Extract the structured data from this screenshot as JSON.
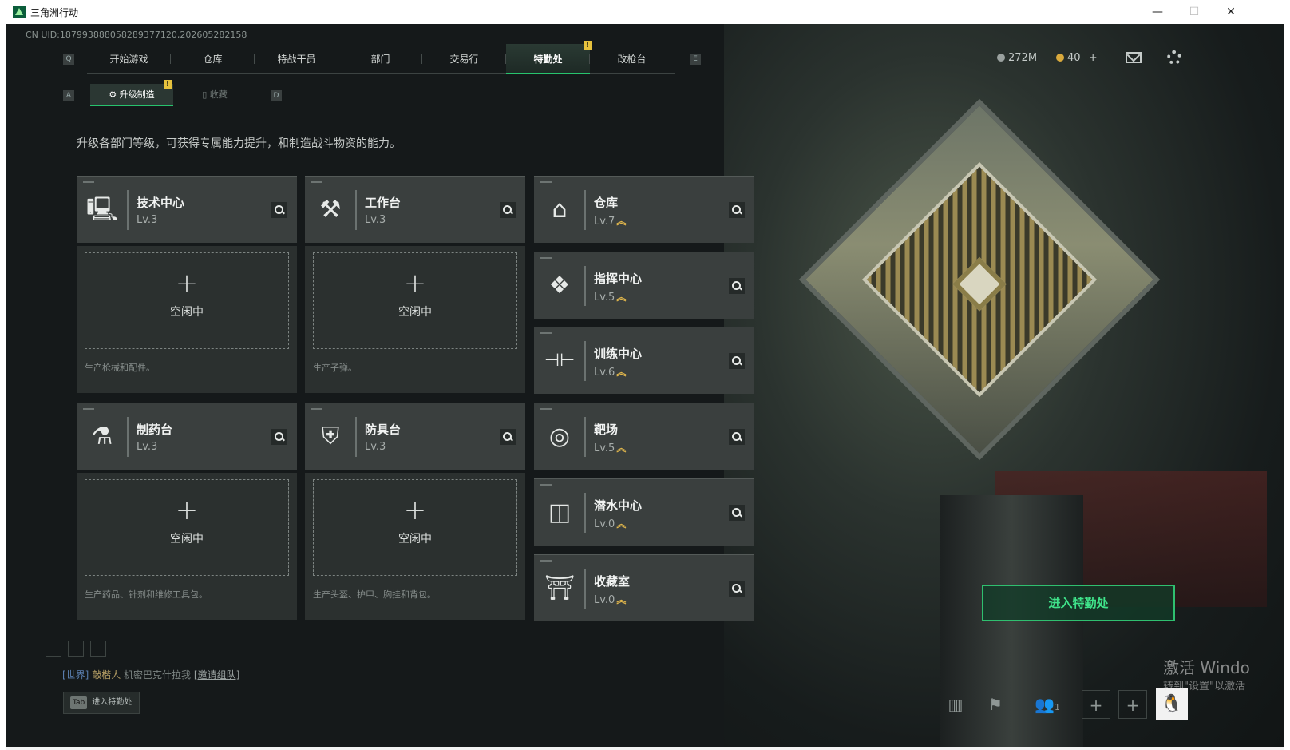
{
  "window": {
    "title": "三角洲行动",
    "minimize": "—",
    "maximize": "☐",
    "close": "✕"
  },
  "uid": "CN UID:1879938880582893771​20,202605282158",
  "nav": {
    "key_left": "Q",
    "key_right": "E",
    "tabs": [
      "开始游戏",
      "仓库",
      "特战干员",
      "部门",
      "交易行",
      "特勤处",
      "改枪台"
    ],
    "active_tab": "特勤处",
    "badge": "!"
  },
  "resources": {
    "money": "272M",
    "coin": "40",
    "coin_plus": "+"
  },
  "subnav": {
    "key_left": "A",
    "key_right": "D",
    "tabs": [
      "升级制造",
      "收藏"
    ],
    "badge": "!"
  },
  "description": "升级各部门等级，可获得专属能力提升，和制造战斗物资的能力。",
  "production": [
    {
      "name": "技术中心",
      "level": "Lv.3",
      "icon": "monitor-icon",
      "glyph": "🖳",
      "slot": "空闲中",
      "plus": "+",
      "note": "生产枪械和配件。"
    },
    {
      "name": "工作台",
      "level": "Lv.3",
      "icon": "tools-icon",
      "glyph": "⚒",
      "slot": "空闲中",
      "plus": "+",
      "note": "生产子弹。"
    },
    {
      "name": "制药台",
      "level": "Lv.3",
      "icon": "microscope-icon",
      "glyph": "⚗",
      "slot": "空闲中",
      "plus": "+",
      "note": "生产药品、针剂和维修工具包。"
    },
    {
      "name": "防具台",
      "level": "Lv.3",
      "icon": "armor-icon",
      "glyph": "⛨",
      "slot": "空闲中",
      "plus": "+",
      "note": "生产头盔、护甲、胸挂和背包。"
    }
  ],
  "departments": [
    {
      "name": "仓库",
      "level": "Lv.7",
      "icon": "warehouse-icon",
      "glyph": "⌂",
      "upgrade": "︽"
    },
    {
      "name": "指挥中心",
      "level": "Lv.5",
      "icon": "command-chip-icon",
      "glyph": "❖",
      "upgrade": "︽"
    },
    {
      "name": "训练中心",
      "level": "Lv.6",
      "icon": "dumbbell-icon",
      "glyph": "⊣⊢",
      "upgrade": "︽"
    },
    {
      "name": "靶场",
      "level": "Lv.5",
      "icon": "target-icon",
      "glyph": "◎",
      "upgrade": "︽"
    },
    {
      "name": "潜水中心",
      "level": "Lv.0",
      "icon": "diving-goggles-icon",
      "glyph": "◫",
      "upgrade": "︽"
    },
    {
      "name": "收藏室",
      "level": "Lv.0",
      "icon": "collection-room-icon",
      "glyph": "⛩",
      "upgrade": "︽"
    }
  ],
  "enter_button": "进入特勤处",
  "chat": {
    "channel": "[世界]",
    "player": "敲楷人",
    "message": "机密巴克什拉我",
    "invite": "[邀请组队]"
  },
  "tab_hint": {
    "key": "Tab",
    "label": "进入特勤处"
  },
  "bottom": {
    "friends_count": "1"
  },
  "watermark": {
    "line1": "激活 Windo",
    "line2": "转到\"设置\"以激活"
  },
  "colors": {
    "accent": "#27c36d",
    "upgrade": "#e0b64c",
    "badge": "#e6c13d"
  }
}
